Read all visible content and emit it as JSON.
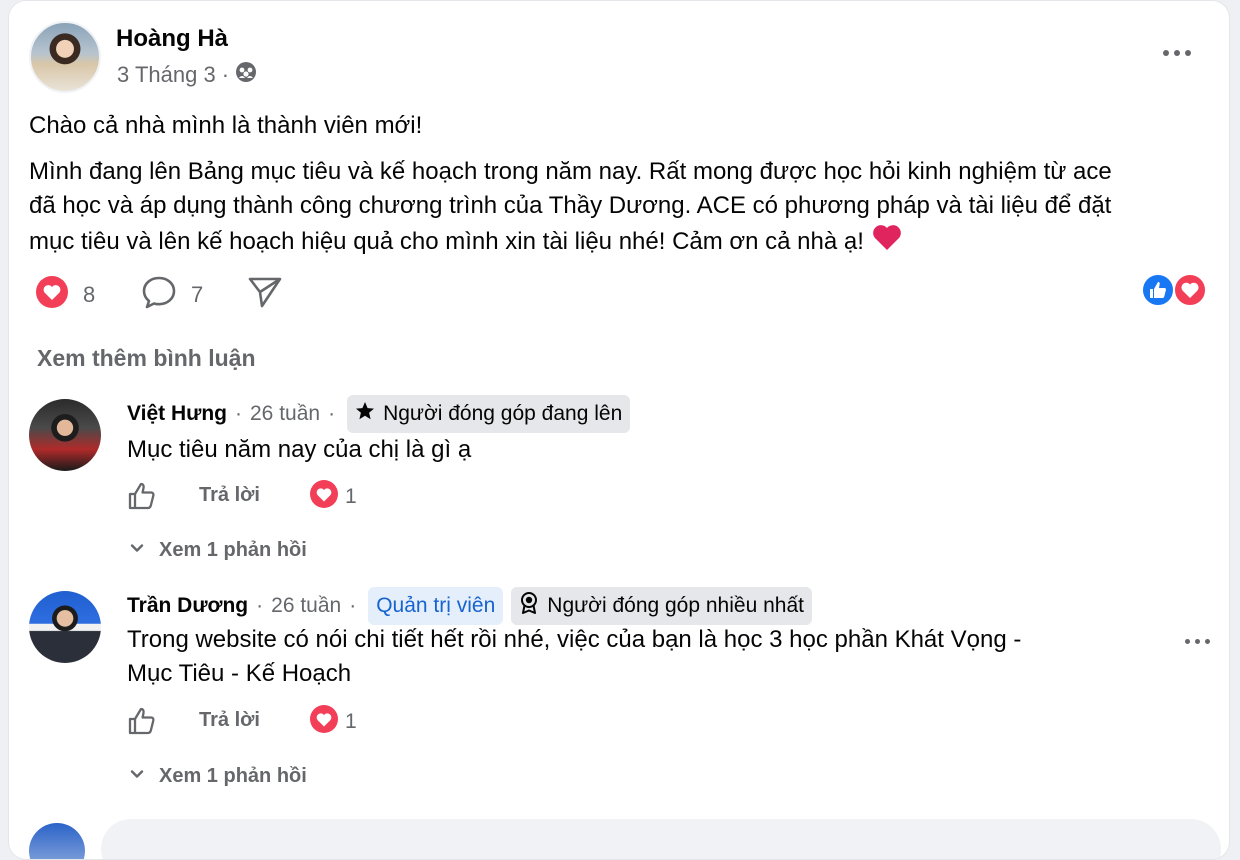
{
  "post": {
    "author": "Hoàng Hà",
    "date": "3 Tháng 3",
    "separator": "·",
    "audience_icon": "group-icon",
    "line1": "Chào cả nhà mình là thành viên mới!",
    "para2_line1": "Mình đang lên Bảng mục tiêu và kế hoạch trong năm nay. Rất mong được học hỏi kinh nghiệm từ ace",
    "para2_line2": "đã học và áp dụng thành công chương trình của Thầy Dương. ACE có phương pháp và tài liệu để đặt",
    "para2_line3": "mục tiêu và lên kế hoạch hiệu quả cho mình xin tài liệu nhé! Cảm ơn cả nhà ạ!",
    "emoji": "❤️",
    "reactions_count": "8",
    "comments_count": "7"
  },
  "see_more_comments": "Xem thêm bình luận",
  "comments": [
    {
      "name": "Việt Hưng",
      "time": "26 tuần",
      "separator": "·",
      "badge": "Người đóng góp đang lên",
      "text_line1": "Mục tiêu năm nay của chị là gì ạ",
      "reply_label": "Trả lời",
      "reaction_count": "1",
      "view_replies": "Xem 1 phản hồi"
    },
    {
      "name": "Trần Dương",
      "time": "26 tuần",
      "separator": "·",
      "admin_badge": "Quản trị viên",
      "badge": "Người đóng góp nhiều nhất",
      "text_line1": "Trong website có nói chi tiết hết rồi nhé, việc của bạn là học 3 học phần Khát Vọng -",
      "text_line2": "Mục Tiêu - Kế Hoạch",
      "reply_label": "Trả lời",
      "reaction_count": "1",
      "view_replies": "Xem 1 phản hồi"
    }
  ],
  "colors": {
    "like_blue": "#1877f2",
    "love_red": "#f33e58",
    "admin_blue": "#1763cf",
    "muted": "#65676b"
  }
}
